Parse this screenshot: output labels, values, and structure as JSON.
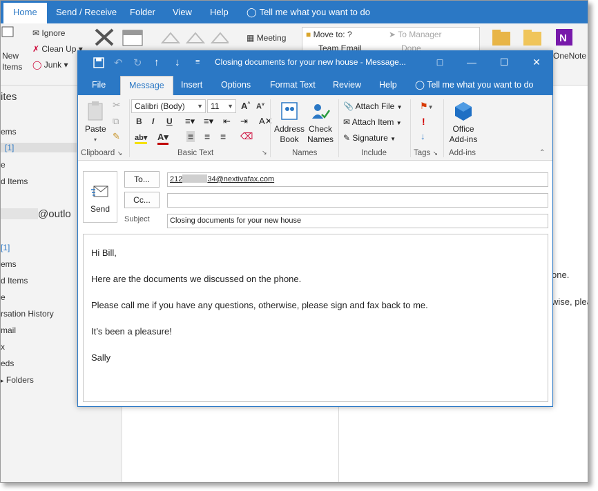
{
  "background": {
    "tabs": [
      "Home",
      "Send / Receive",
      "Folder",
      "View",
      "Help"
    ],
    "tell_me": "Tell me what you want to do",
    "ribbon": {
      "ignore": "Ignore",
      "clean_up": "Clean Up",
      "junk": "Junk",
      "new_items_1": "New",
      "new_items_2": "Items",
      "meeting": "Meeting",
      "move_to": "Move to: ?",
      "to_manager": "To Manager",
      "team_email": "Team Email",
      "done": "Done",
      "onenote": "OneNote"
    },
    "nav": {
      "favorites": "ites",
      "items_a": "ems",
      "count_a": "[1]",
      "e_a": "e",
      "deleted_a": "d Items",
      "account": "@outlo",
      "count_b": "[1]",
      "items_b": "ems",
      "deleted_b": "d Items",
      "e_b": "e",
      "conv_history": "rsation History",
      "mail": "mail",
      "x": "x",
      "feeds": "eds",
      "folders": "Folders"
    },
    "reading": {
      "line1": "one.",
      "line2": "wise, plea"
    }
  },
  "compose": {
    "title": "Closing documents for your new house  -  Message...",
    "tabs": [
      "File",
      "Message",
      "Insert",
      "Options",
      "Format Text",
      "Review",
      "Help"
    ],
    "tell_me": "Tell me what you want to do",
    "ribbon": {
      "paste": "Paste",
      "font_name": "Calibri (Body)",
      "font_size": "11",
      "address_book_1": "Address",
      "address_book_2": "Book",
      "check_names_1": "Check",
      "check_names_2": "Names",
      "attach_file": "Attach File",
      "attach_item": "Attach Item",
      "signature": "Signature",
      "office_addins_1": "Office",
      "office_addins_2": "Add-ins",
      "groups": {
        "clipboard": "Clipboard",
        "basic_text": "Basic Text",
        "names": "Names",
        "include": "Include",
        "tags": "Tags",
        "addins": "Add-ins"
      }
    },
    "send_label": "Send",
    "to_button": "To...",
    "cc_button": "Cc...",
    "subject_label": "Subject",
    "to_value_prefix": "212",
    "to_value_suffix": "34@nextivafax.com",
    "cc_value": "",
    "subject_value": "Closing documents for your new house",
    "body": [
      "Hi Bill,",
      "Here are the documents we discussed on the phone.",
      "Please call me if you have any questions, otherwise, please sign and fax back to me.",
      "It’s been a pleasure!",
      "Sally"
    ]
  },
  "colors": {
    "accent": "#2b78c5",
    "ribbon_bg": "#f3f3f3",
    "flag_red": "#d83b01"
  }
}
